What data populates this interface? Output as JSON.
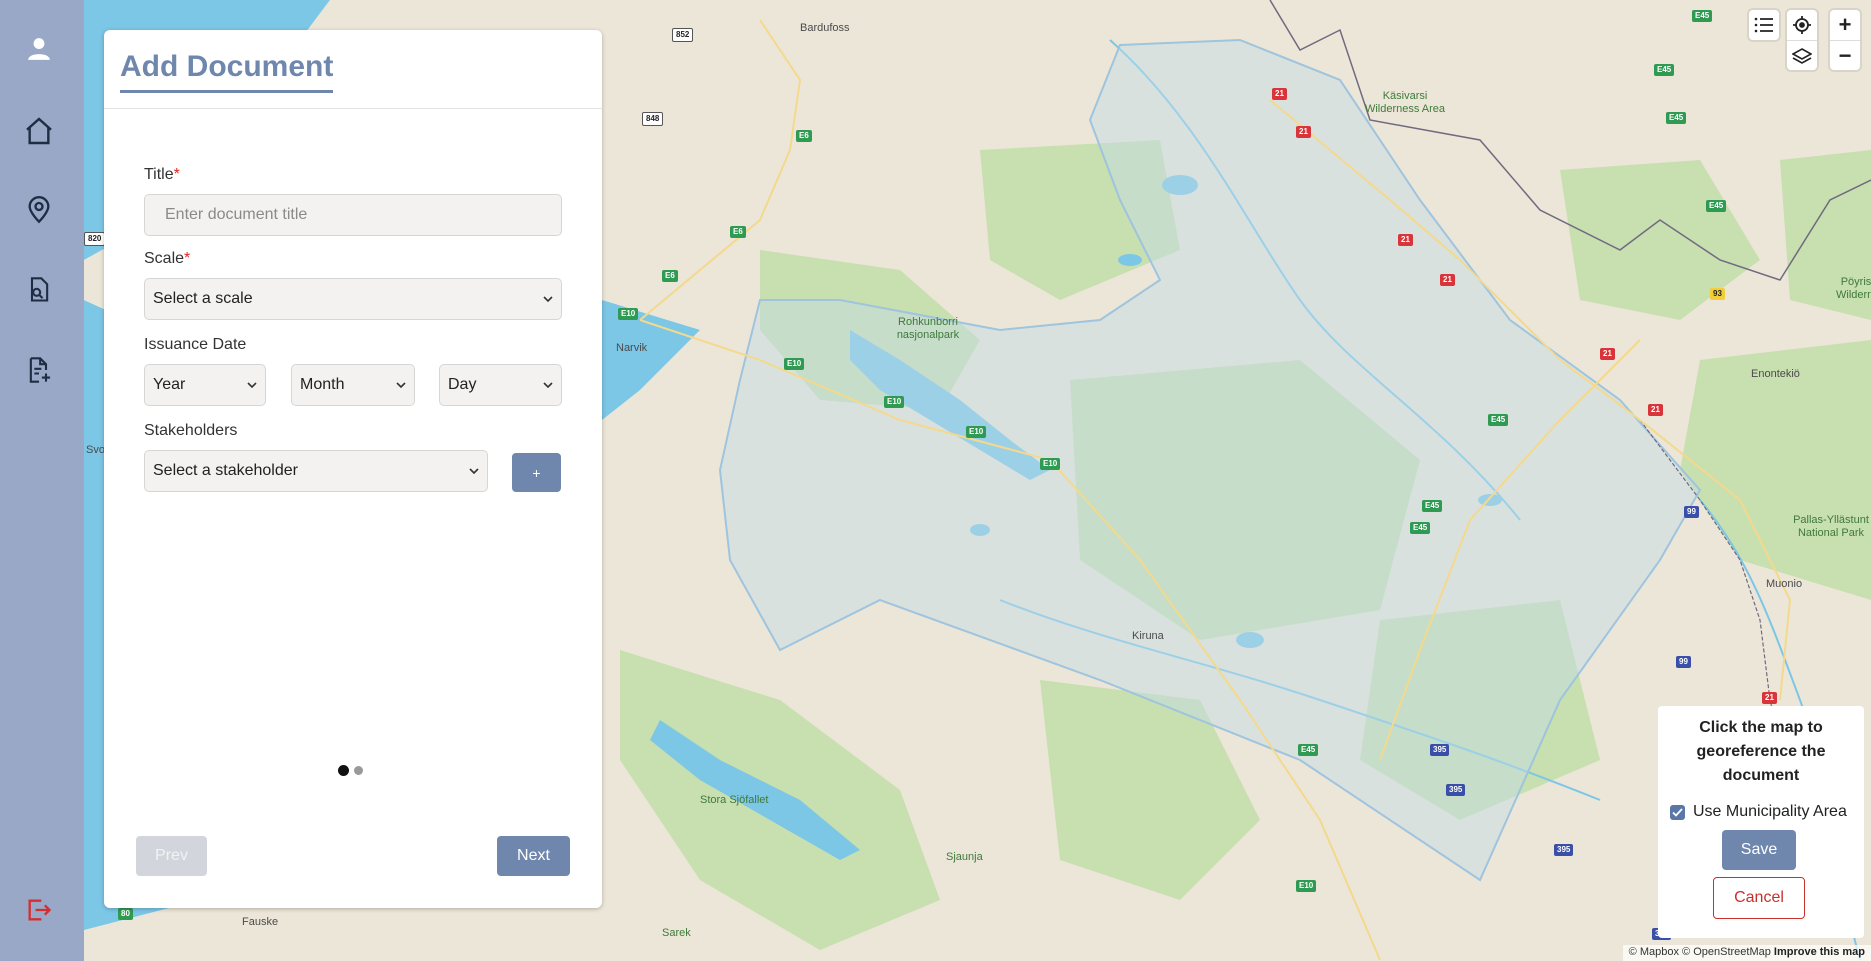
{
  "sidebar": {
    "items": [
      {
        "icon": "user-icon"
      },
      {
        "icon": "home-icon"
      },
      {
        "icon": "map-pin-icon"
      },
      {
        "icon": "search-document-icon"
      },
      {
        "icon": "add-document-icon"
      }
    ],
    "logout_icon": "logout-icon"
  },
  "panel": {
    "title": "Add Document",
    "title_field": {
      "label": "Title",
      "required_mark": "*",
      "placeholder": "Enter document title"
    },
    "scale_field": {
      "label": "Scale",
      "required_mark": "*",
      "value": "Select a scale"
    },
    "issuance": {
      "label": "Issuance Date",
      "year": "Year",
      "month": "Month",
      "day": "Day"
    },
    "stakeholders": {
      "label": "Stakeholders",
      "value": "Select a stakeholder",
      "add_label": "+"
    },
    "pagination": {
      "current": 1,
      "total": 2
    },
    "prev_label": "Prev",
    "next_label": "Next"
  },
  "map": {
    "places": [
      "Bardufoss",
      "Käsivarsi Wilderness Area",
      "Rohkunborri nasjonalpark",
      "Narvik",
      "Kiruna",
      "Enontekiö",
      "Pöyris Wilderne",
      "Pallas-Yllästunt National Park",
      "Muonio",
      "Stora Sjöfallet",
      "Sjaunja",
      "Sarek",
      "Fauske",
      "Svo"
    ],
    "routes": [
      "852",
      "848",
      "E6",
      "E10",
      "E45",
      "21",
      "93",
      "99",
      "395",
      "820",
      "80"
    ],
    "controls": [
      "list-icon",
      "locate-icon",
      "layers-icon",
      "zoom-in-icon",
      "zoom-out-icon"
    ],
    "colors": {
      "land": "#ece6d8",
      "water": "#7cc6e6",
      "forest": "#c8dfb0",
      "municipality": "#b9d6e8"
    }
  },
  "georef": {
    "instruction": "Click the map to georeference the document",
    "use_municipality_label": "Use Municipality Area",
    "use_municipality_checked": true,
    "save_label": "Save",
    "cancel_label": "Cancel"
  },
  "attribution": {
    "mapbox": "© Mapbox",
    "osm": "© OpenStreetMap",
    "improve": "Improve this map"
  }
}
